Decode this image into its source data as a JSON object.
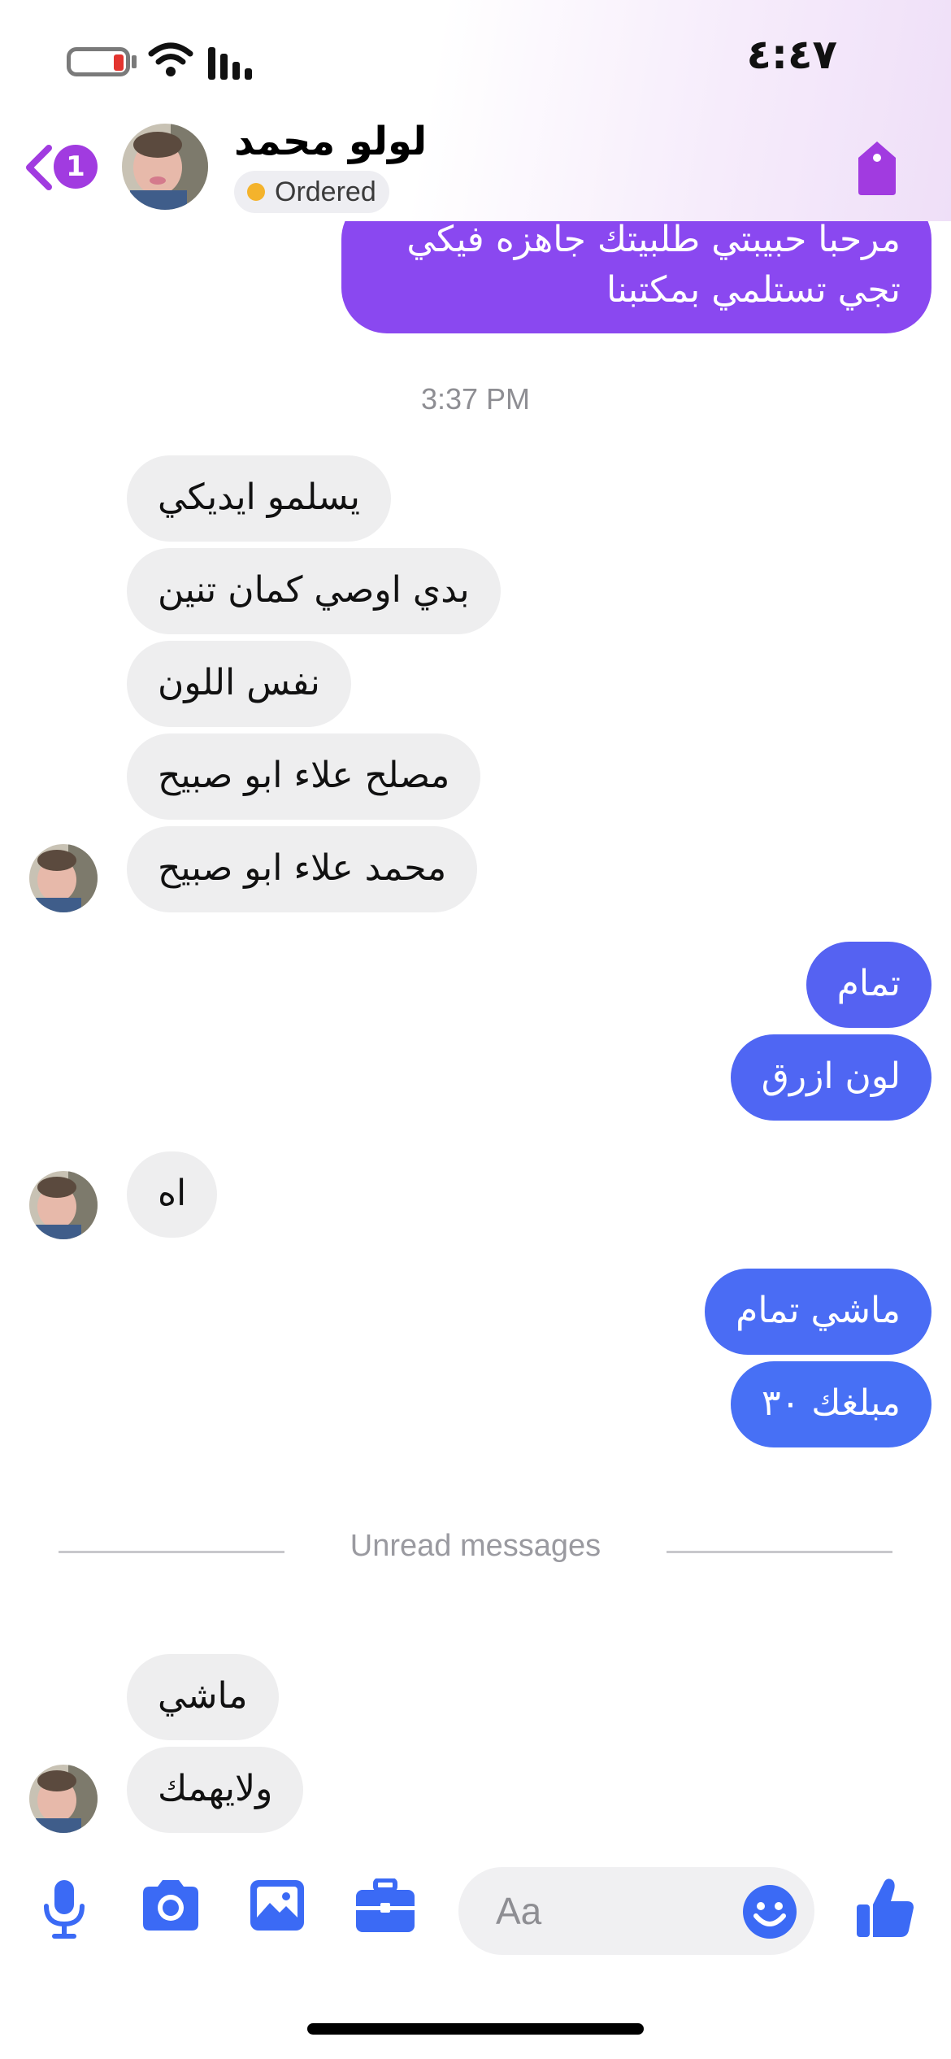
{
  "status_bar": {
    "time": "٤:٤٧"
  },
  "header": {
    "unread_count": "1",
    "contact_name": "لولو محمد",
    "status_chip": "Ordered",
    "colors": {
      "accent": "#a13be0",
      "chip_dot": "#f4b32c"
    },
    "icons": [
      "chevron-left-icon",
      "tag-icon"
    ]
  },
  "messages": {
    "sent_top": {
      "line1": "مرحبا حبيبتي طلبيتك جاهزه فيكي",
      "line2": "تجي تستلمي بمكتبنا"
    },
    "timestamp": "3:37 PM",
    "received_group1": [
      "يسلمو ايديكي",
      "بدي اوصي كمان تنين",
      "نفس اللون",
      "مصلح علاء ابو صبيح",
      "محمد علاء ابو صبيح"
    ],
    "sent_group1": [
      "تمام",
      "لون ازرق"
    ],
    "received_group2": [
      "اه"
    ],
    "sent_group2": [
      "ماشي تمام",
      "مبلغك ٣٠"
    ],
    "unread_divider": "Unread messages",
    "received_group3": [
      "ماشي",
      "ولايهمك"
    ]
  },
  "composer": {
    "placeholder": "Aa",
    "icons": [
      "microphone-icon",
      "camera-icon",
      "photo-icon",
      "briefcase-icon",
      "emoji-icon",
      "thumbs-up-icon"
    ],
    "accent": "#3b6af5"
  }
}
